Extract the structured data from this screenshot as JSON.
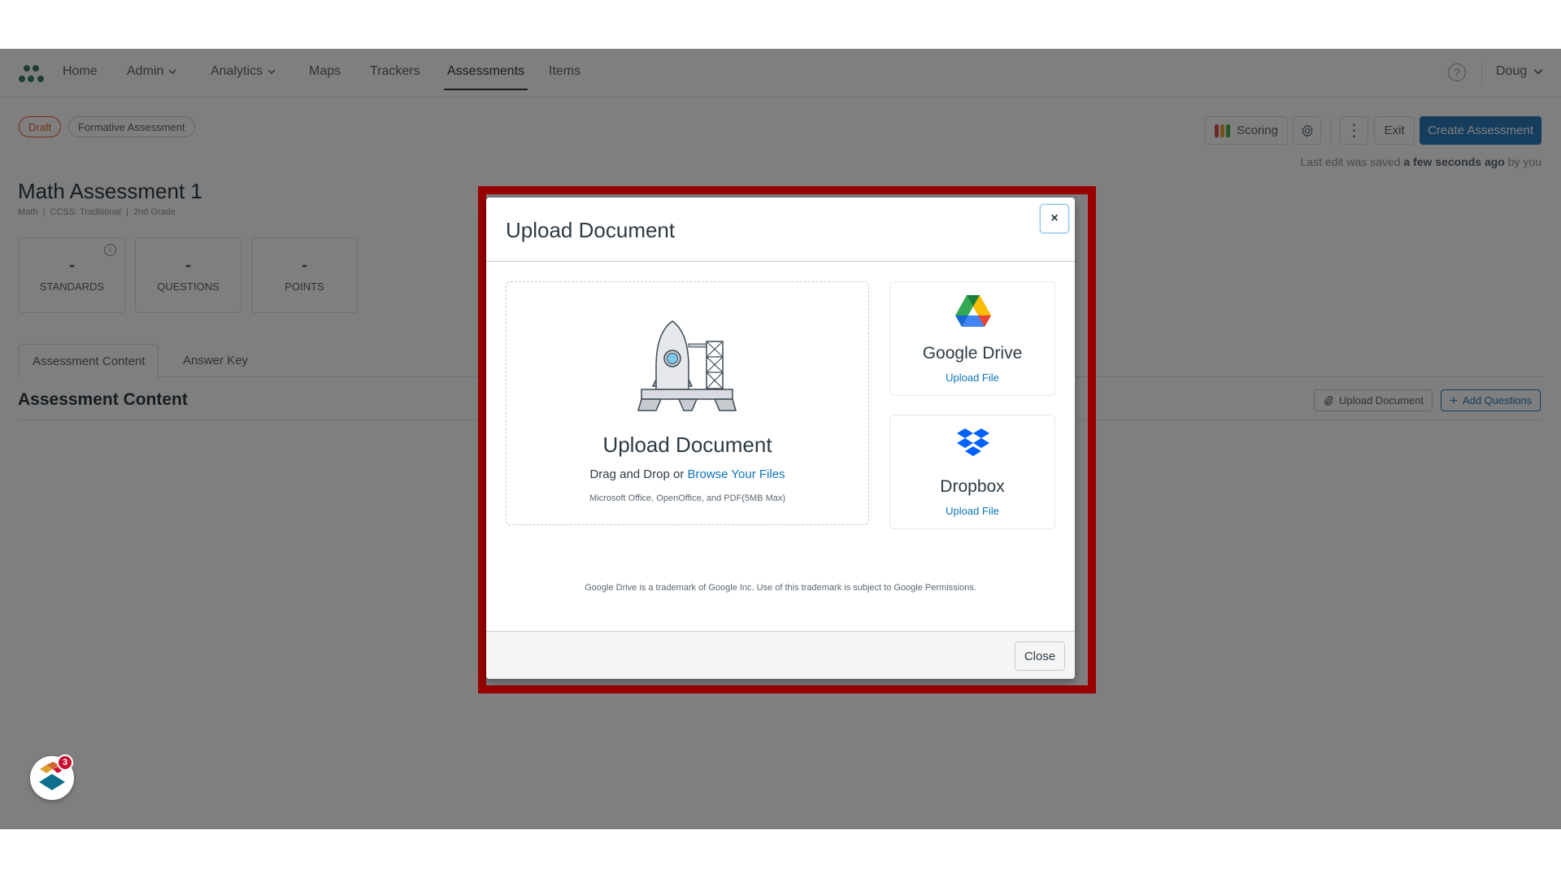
{
  "nav": {
    "items": [
      {
        "label": "Home",
        "has_dropdown": false,
        "active": false
      },
      {
        "label": "Admin",
        "has_dropdown": true,
        "active": false
      },
      {
        "label": "Analytics",
        "has_dropdown": true,
        "active": false
      },
      {
        "label": "Maps",
        "has_dropdown": false,
        "active": false
      },
      {
        "label": "Trackers",
        "has_dropdown": false,
        "active": false
      },
      {
        "label": "Assessments",
        "has_dropdown": false,
        "active": true
      },
      {
        "label": "Items",
        "has_dropdown": false,
        "active": false
      }
    ],
    "help_icon": "?",
    "user_name": "Doug"
  },
  "assessment": {
    "status_pill": "Draft",
    "type_pill": "Formative Assessment",
    "title": "Math Assessment 1",
    "subtitle": "Math  |  CCSS: Traditional  |  2nd Grade",
    "stats": [
      {
        "value": "-",
        "label": "STANDARDS",
        "has_info": true
      },
      {
        "value": "-",
        "label": "QUESTIONS",
        "has_info": false
      },
      {
        "value": "-",
        "label": "POINTS",
        "has_info": false
      }
    ],
    "tabs": [
      {
        "label": "Assessment Content",
        "active": true
      },
      {
        "label": "Answer Key",
        "active": false
      }
    ],
    "section_title": "Assessment Content",
    "upload_document_label": "Upload Document",
    "add_questions_label": "Add Questions"
  },
  "toolbar": {
    "scoring_label": "Scoring",
    "exit_label": "Exit",
    "create_label": "Create Assessment",
    "last_edit_prefix": "Last edit was saved",
    "last_edit_time": "a few seconds ago",
    "last_edit_suffix": "by you",
    "scoring_colors": [
      "#d9534f",
      "#e8a33d",
      "#4caf50"
    ]
  },
  "widget": {
    "badge_count": "3"
  },
  "modal": {
    "title": "Upload Document",
    "close_x": "×",
    "dropzone": {
      "title": "Upload Document",
      "drag_text": "Drag and Drop or ",
      "browse_link": "Browse Your Files",
      "note": "Microsoft Office, OpenOffice, and PDF(5MB Max)"
    },
    "services": [
      {
        "name": "Google Drive",
        "link": "Upload File"
      },
      {
        "name": "Dropbox",
        "link": "Upload File"
      }
    ],
    "trademark": "Google Drive is a trademark of Google Inc. Use of this trademark is subject to Google Permissions.",
    "close_label": "Close"
  },
  "colors": {
    "highlight": "#990000",
    "link": "#0e74b8",
    "primary": "#2b7abc",
    "draft": "#e66135",
    "dropbox": "#0061fe"
  }
}
